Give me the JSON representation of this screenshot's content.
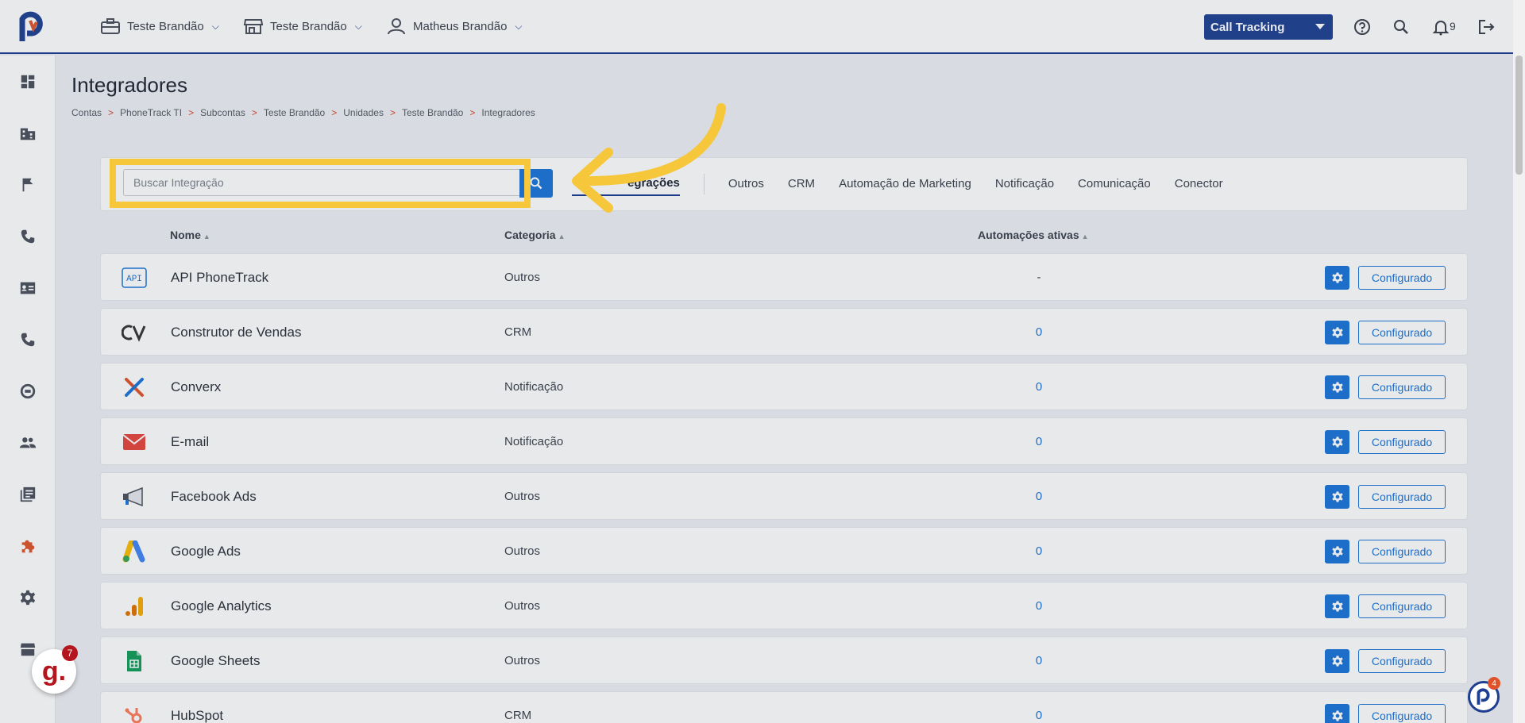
{
  "header": {
    "menus": [
      {
        "label": "Teste Brandão",
        "icon": "briefcase-icon"
      },
      {
        "label": "Teste Brandão",
        "icon": "store-icon"
      },
      {
        "label": "Matheus Brandão",
        "icon": "user-icon"
      }
    ],
    "product_selector": "Call Tracking",
    "notification_count": "9"
  },
  "page": {
    "title": "Integradores",
    "breadcrumb": [
      "Contas",
      "PhoneTrack TI",
      "Subcontas",
      "Teste Brandão",
      "Unidades",
      "Teste Brandão",
      "Integradores"
    ],
    "breadcrumb_sep": ">"
  },
  "search": {
    "placeholder": "Buscar Integração",
    "value": ""
  },
  "tabs": [
    "Integrações",
    "Outros",
    "CRM",
    "Automação de Marketing",
    "Notificação",
    "Comunicação",
    "Conector"
  ],
  "active_tab_visible_text": "egrações",
  "table": {
    "headers": {
      "name": "Nome",
      "category": "Categoria",
      "automations": "Automações ativas"
    },
    "rows": [
      {
        "name": "API PhoneTrack",
        "category": "Outros",
        "automations": "-",
        "icon": "api-icon",
        "button": "Configurado"
      },
      {
        "name": "Construtor de Vendas",
        "category": "CRM",
        "automations": "0",
        "icon": "cv-logo-icon",
        "button": "Configurado"
      },
      {
        "name": "Converx",
        "category": "Notificação",
        "automations": "0",
        "icon": "converx-logo-icon",
        "button": "Configurado"
      },
      {
        "name": "E-mail",
        "category": "Notificação",
        "automations": "0",
        "icon": "email-icon",
        "button": "Configurado"
      },
      {
        "name": "Facebook Ads",
        "category": "Outros",
        "automations": "0",
        "icon": "megaphone-icon",
        "button": "Configurado"
      },
      {
        "name": "Google Ads",
        "category": "Outros",
        "automations": "0",
        "icon": "google-ads-icon",
        "button": "Configurado"
      },
      {
        "name": "Google Analytics",
        "category": "Outros",
        "automations": "0",
        "icon": "google-analytics-icon",
        "button": "Configurado"
      },
      {
        "name": "Google Sheets",
        "category": "Outros",
        "automations": "0",
        "icon": "google-sheets-icon",
        "button": "Configurado"
      },
      {
        "name": "HubSpot",
        "category": "CRM",
        "automations": "0",
        "icon": "hubspot-icon",
        "button": "Configurado"
      }
    ]
  },
  "floating": {
    "g_badge_letter": "g.",
    "g_badge_count": "7",
    "p_badge_count": "4"
  },
  "colors": {
    "brand_blue": "#1e3f91",
    "action_blue": "#1a73d9",
    "accent_orange": "#e0522a",
    "highlight_yellow": "#f6c73b"
  }
}
